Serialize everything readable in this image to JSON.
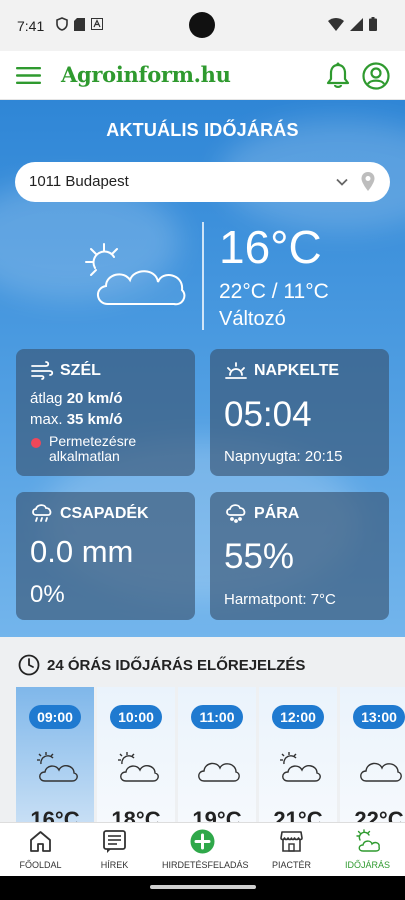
{
  "status_bar": {
    "time": "7:41"
  },
  "header": {
    "logo": "Agroinform.hu"
  },
  "weather": {
    "title": "AKTUÁLIS IDŐJÁRÁS",
    "location": "1011 Budapest",
    "current_temp": "16°C",
    "temp_range": "22°C / 11°C",
    "condition": "Változó",
    "wind": {
      "title": "SZÉL",
      "avg_prefix": "átlag",
      "avg_value": "20 km/ó",
      "max_prefix": "max.",
      "max_value": "35 km/ó",
      "spray_status": "Permetezésre alkalmatlan",
      "spray_color": "#f0475a"
    },
    "sunrise": {
      "title": "NAPKELTE",
      "value": "05:04",
      "sunset": "Napnyugta: 20:15"
    },
    "precipitation": {
      "title": "CSAPADÉK",
      "amount": "0.0 mm",
      "chance": "0%"
    },
    "humidity": {
      "title": "PÁRA",
      "value": "55%",
      "dewpoint": "Harmatpont: 7°C"
    }
  },
  "forecast": {
    "title": "24 ÓRÁS IDŐJÁRÁS ELŐREJELZÉS",
    "hours": [
      {
        "time": "09:00",
        "temp": "16°C",
        "icon": "partly-cloudy-icon"
      },
      {
        "time": "10:00",
        "temp": "18°C",
        "icon": "partly-cloudy-icon"
      },
      {
        "time": "11:00",
        "temp": "19°C",
        "icon": "cloud-icon"
      },
      {
        "time": "12:00",
        "temp": "21°C",
        "icon": "partly-cloudy-icon"
      },
      {
        "time": "13:00",
        "temp": "22°C",
        "icon": "cloud-icon"
      }
    ]
  },
  "bottom_nav": {
    "items": [
      {
        "label": "FŐOLDAL",
        "icon": "home-icon"
      },
      {
        "label": "HÍREK",
        "icon": "news-icon"
      },
      {
        "label": "HIRDETÉSFELADÁS",
        "icon": "add-icon"
      },
      {
        "label": "PIACTÉR",
        "icon": "market-icon"
      },
      {
        "label": "IDŐJÁRÁS",
        "icon": "weather-icon"
      }
    ],
    "active_color": "#2f9a2f"
  },
  "colors": {
    "brand_green": "#2f9a2f",
    "sky_blue": "#2f86d6",
    "pill_blue": "#1f7ad0"
  }
}
